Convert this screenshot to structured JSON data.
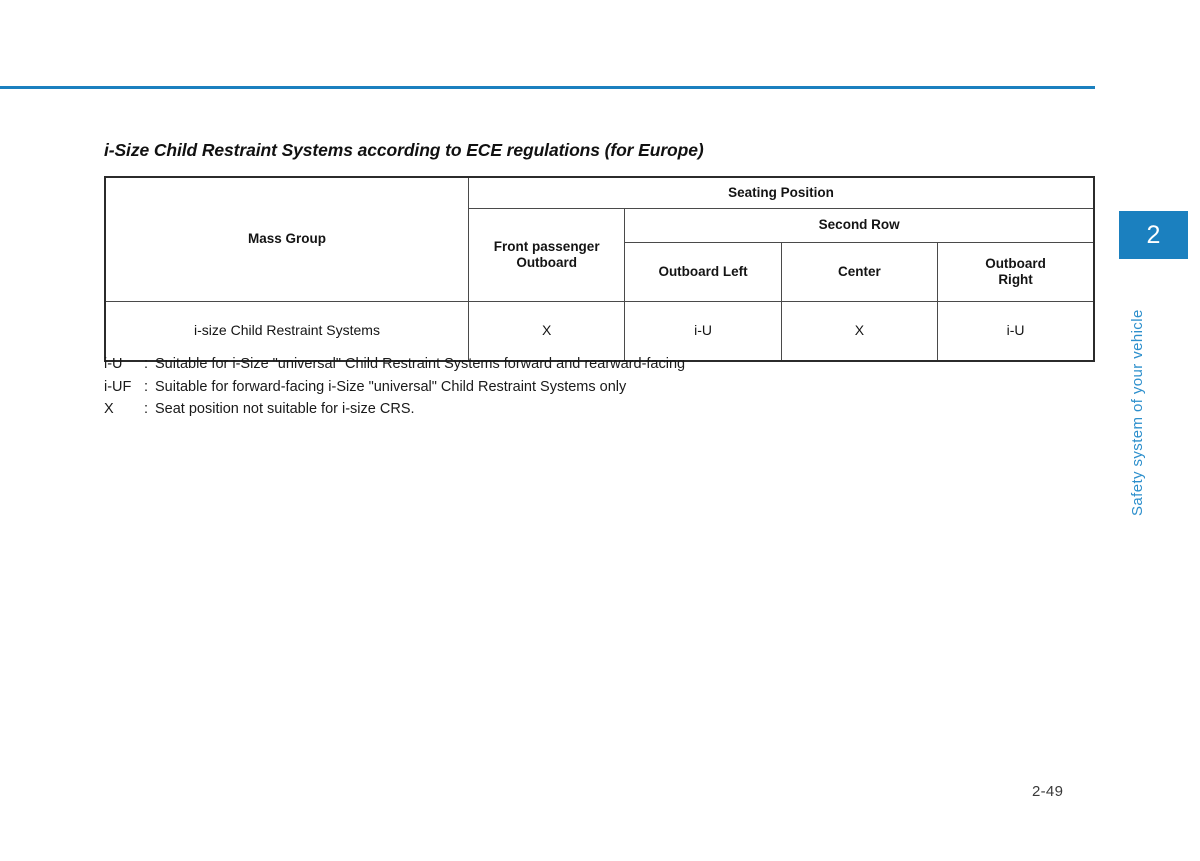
{
  "page": {
    "number": "2-49",
    "accent_color": "#1b80bf",
    "rule_color": "#1b80bf"
  },
  "chapter_tab": {
    "number": "2",
    "label": "Safety system of your vehicle",
    "box_color": "#1b80bf",
    "label_color": "#2d8fcc"
  },
  "section": {
    "heading": "i-Size Child Restraint Systems according to ECE regulations (for Europe)"
  },
  "table": {
    "group_header": "Seating Position",
    "mass_group_header": "Mass Group",
    "second_row_header": "Second Row",
    "columns": [
      "Front passenger Outboard",
      "Outboard Left",
      "Center",
      "Outboard Right"
    ],
    "front_passenger_line1": "Front passenger",
    "front_passenger_line2": "Outboard",
    "outboard_left": "Outboard Left",
    "center": "Center",
    "outboard_right_line1": "Outboard",
    "outboard_right_line2": "Right",
    "rows": [
      {
        "mass_group": "i-size Child Restraint Systems",
        "front_passenger_outboard": "X",
        "second_row_outboard_left": "i-U",
        "second_row_center": "X",
        "second_row_outboard_right": "i-U"
      }
    ]
  },
  "legend": [
    {
      "key": "i-U",
      "colon": ":",
      "text": "Suitable for i-Size \"universal\" Child Restraint Systems forward and rearward-facing"
    },
    {
      "key": "i-UF",
      "colon": ":",
      "text": "Suitable for forward-facing i-Size \"universal\" Child Restraint Systems only"
    },
    {
      "key": "X",
      "colon": ":",
      "text": "Seat position not suitable for i-size CRS."
    }
  ]
}
